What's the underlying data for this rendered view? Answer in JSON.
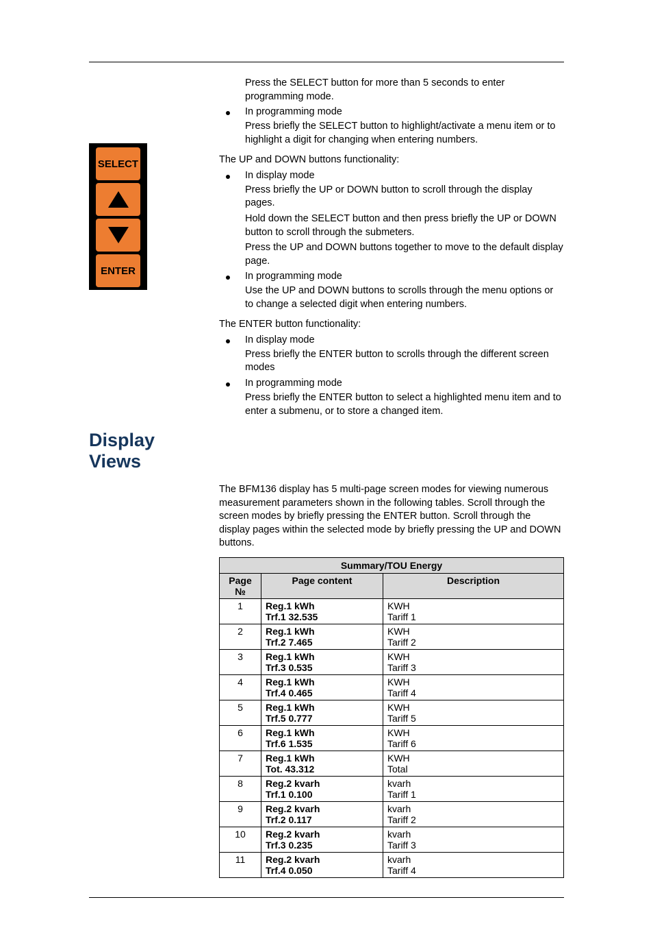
{
  "buttons": {
    "select": "SELECT",
    "enter": "ENTER"
  },
  "top_block": {
    "p1": "Press the SELECT button for more than 5 seconds to enter programming mode.",
    "b1": "In programming mode",
    "p2": "Press briefly the SELECT button to highlight/activate a menu item or to highlight a digit for changing when entering numbers."
  },
  "updown": {
    "intro": "The UP and DOWN buttons functionality:",
    "b1": "In display mode",
    "p1": "Press briefly the UP or DOWN button to scroll through the display pages.",
    "p2": "Hold down the SELECT button and then press briefly the UP or DOWN button to scroll through the submeters.",
    "p3": "Press the UP and DOWN buttons together to move to the default display page.",
    "b2": "In programming mode",
    "p4": "Use the UP and DOWN buttons to scrolls through the menu options or to change a selected digit when entering numbers."
  },
  "enterbtn": {
    "intro": "The ENTER button functionality:",
    "b1": "In display mode",
    "p1": "Press briefly the ENTER button to scrolls through the different screen modes",
    "b2": "In programming mode",
    "p2": "Press briefly the ENTER button to select a highlighted menu item and to enter a submenu, or to store a changed item."
  },
  "section_heading": "Display Views",
  "intro": "The BFM136 display has 5 multi-page screen modes for viewing numerous measurement parameters shown in the following tables. Scroll through the screen modes by briefly pressing the ENTER button. Scroll through the display pages within the selected mode by briefly pressing the UP and DOWN buttons.",
  "table": {
    "title": "Summary/TOU Energy",
    "headers": {
      "page": "Page №",
      "content": "Page content",
      "desc": "Description"
    },
    "rows": [
      {
        "n": "1",
        "c1": "Reg.1  kWh",
        "c2": "Trf.1  32.535",
        "d1": "KWH",
        "d2": "Tariff 1"
      },
      {
        "n": "2",
        "c1": "Reg.1  kWh",
        "c2": "Trf.2  7.465",
        "d1": "KWH",
        "d2": "Tariff 2"
      },
      {
        "n": "3",
        "c1": "Reg.1  kWh",
        "c2": "Trf.3  0.535",
        "d1": "KWH",
        "d2": "Tariff 3"
      },
      {
        "n": "4",
        "c1": "Reg.1  kWh",
        "c2": "Trf.4  0.465",
        "d1": "KWH",
        "d2": "Tariff 4"
      },
      {
        "n": "5",
        "c1": "Reg.1  kWh",
        "c2": "Trf.5  0.777",
        "d1": "KWH",
        "d2": "Tariff 5"
      },
      {
        "n": "6",
        "c1": "Reg.1  kWh",
        "c2": "Trf.6  1.535",
        "d1": "KWH",
        "d2": "Tariff 6"
      },
      {
        "n": "7",
        "c1": "Reg.1  kWh",
        "c2": "Tot.  43.312",
        "d1": "KWH",
        "d2": "Total"
      },
      {
        "n": "8",
        "c1": "Reg.2  kvarh",
        "c2": "Trf.1  0.100",
        "d1": "kvarh",
        "d2": "Tariff 1"
      },
      {
        "n": "9",
        "c1": "Reg.2  kvarh",
        "c2": "Trf.2  0.117",
        "d1": "kvarh",
        "d2": "Tariff 2"
      },
      {
        "n": "10",
        "c1": "Reg.2  kvarh",
        "c2": "Trf.3  0.235",
        "d1": "kvarh",
        "d2": "Tariff 3"
      },
      {
        "n": "11",
        "c1": "Reg.2  kvarh",
        "c2": "Trf.4  0.050",
        "d1": "kvarh",
        "d2": "Tariff 4"
      }
    ]
  }
}
